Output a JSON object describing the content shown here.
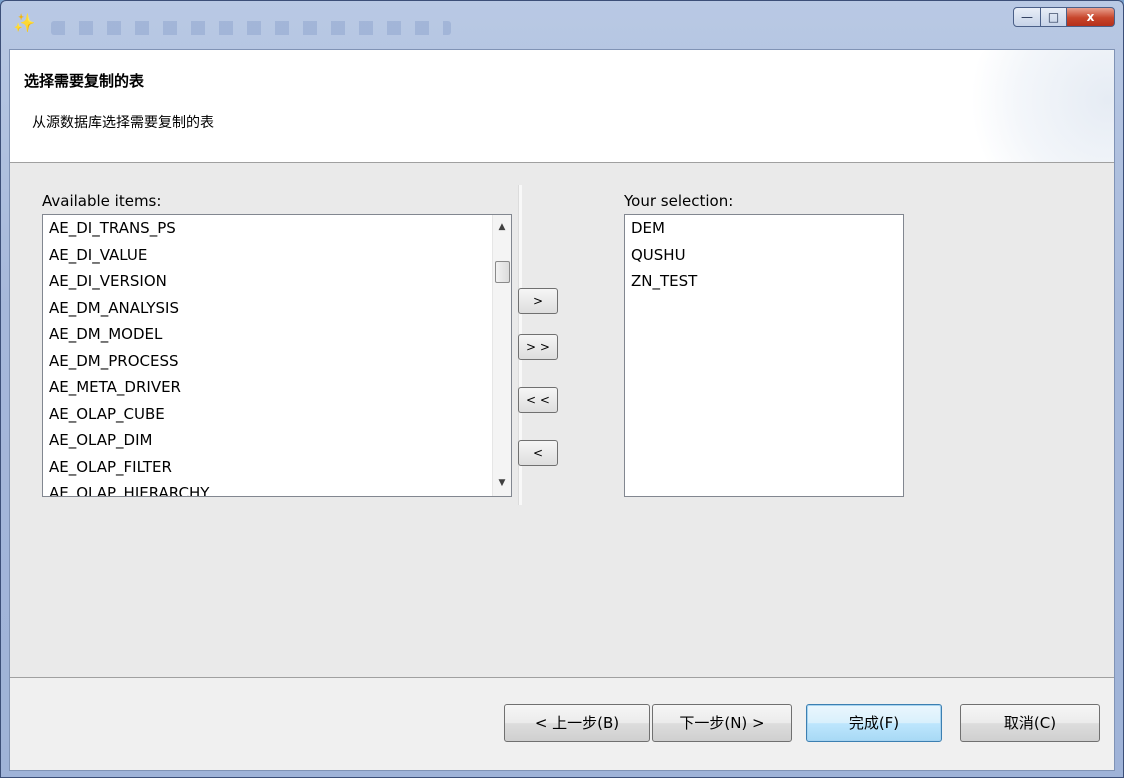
{
  "window": {
    "app_icon": "wizard-icon",
    "controls": {
      "minimize": "—",
      "maximize": "□",
      "close": "x"
    }
  },
  "header": {
    "title": "选择需要复制的表",
    "description": "从源数据库选择需要复制的表"
  },
  "available": {
    "label": "Available items:",
    "items": [
      "AE_DI_TRANS_PS",
      "AE_DI_VALUE",
      "AE_DI_VERSION",
      "AE_DM_ANALYSIS",
      "AE_DM_MODEL",
      "AE_DM_PROCESS",
      "AE_META_DRIVER",
      "AE_OLAP_CUBE",
      "AE_OLAP_DIM",
      "AE_OLAP_FILTER",
      "AE_OLAP_HIERARCHY"
    ],
    "scroll_up": "▲",
    "scroll_down": "▼"
  },
  "move_buttons": {
    "add": ">",
    "add_all": "> >",
    "remove_all": "< <",
    "remove": "<"
  },
  "selection": {
    "label": "Your selection:",
    "items": [
      "DEM",
      "QUSHU",
      "ZN_TEST"
    ]
  },
  "footer": {
    "back": "< 上一步(B)",
    "next": "下一步(N) >",
    "finish": "完成(F)",
    "cancel": "取消(C)"
  }
}
